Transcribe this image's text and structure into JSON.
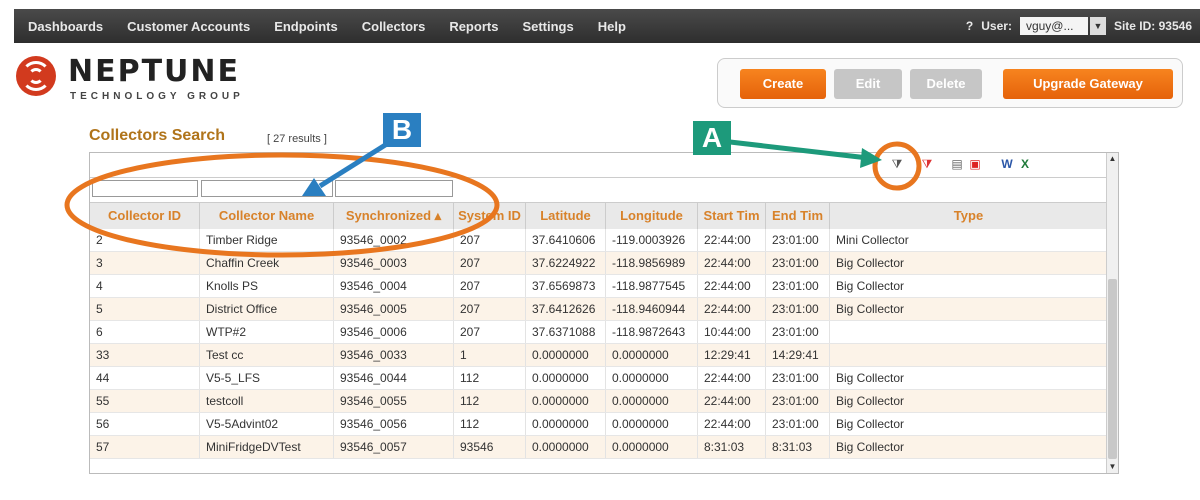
{
  "nav": {
    "items": [
      "Dashboards",
      "Customer Accounts",
      "Endpoints",
      "Collectors",
      "Reports",
      "Settings",
      "Help"
    ],
    "help": "?",
    "user_label": "User:",
    "user_value": "vguy@...",
    "site_label": "Site ID: 93546"
  },
  "logo": {
    "name": "NEPTUNE",
    "sub": "TECHNOLOGY GROUP"
  },
  "buttons": {
    "create": "Create",
    "edit": "Edit",
    "delete": "Delete",
    "upgrade": "Upgrade Gateway"
  },
  "search": {
    "title": "Collectors Search",
    "results": "[ 27 results ]"
  },
  "table": {
    "headers": [
      "Collector ID",
      "Collector Name",
      "Synchronized ▴",
      "System ID",
      "Latitude",
      "Longitude",
      "Start Tim",
      "End Tim",
      "Type"
    ],
    "rows": [
      [
        "2",
        "Timber Ridge",
        "93546_0002",
        "207",
        "37.6410606",
        "-119.0003926",
        "22:44:00",
        "23:01:00",
        "Mini Collector"
      ],
      [
        "3",
        "Chaffin Creek",
        "93546_0003",
        "207",
        "37.6224922",
        "-118.9856989",
        "22:44:00",
        "23:01:00",
        "Big Collector"
      ],
      [
        "4",
        "Knolls PS",
        "93546_0004",
        "207",
        "37.6569873",
        "-118.9877545",
        "22:44:00",
        "23:01:00",
        "Big Collector"
      ],
      [
        "5",
        "District Office",
        "93546_0005",
        "207",
        "37.6412626",
        "-118.9460944",
        "22:44:00",
        "23:01:00",
        "Big Collector"
      ],
      [
        "6",
        "WTP#2",
        "93546_0006",
        "207",
        "37.6371088",
        "-118.9872643",
        "10:44:00",
        "23:01:00",
        ""
      ],
      [
        "33",
        "Test cc",
        "93546_0033",
        "1",
        "0.0000000",
        "0.0000000",
        "12:29:41",
        "14:29:41",
        ""
      ],
      [
        "44",
        "V5-5_LFS",
        "93546_0044",
        "112",
        "0.0000000",
        "0.0000000",
        "22:44:00",
        "23:01:00",
        "Big Collector"
      ],
      [
        "55",
        "testcoll",
        "93546_0055",
        "112",
        "0.0000000",
        "0.0000000",
        "22:44:00",
        "23:01:00",
        "Big Collector"
      ],
      [
        "56",
        "V5-5Advint02",
        "93546_0056",
        "112",
        "0.0000000",
        "0.0000000",
        "22:44:00",
        "23:01:00",
        "Big Collector"
      ],
      [
        "57",
        "MiniFridgeDVTest",
        "93546_0057",
        "93546",
        "0.0000000",
        "0.0000000",
        "8:31:03",
        "8:31:03",
        "Big Collector"
      ]
    ]
  },
  "annotations": {
    "a": "A",
    "b": "B"
  },
  "colors": {
    "accent": "#e5620a",
    "header_text": "#d8822a",
    "annotation_green": "#1d9a7b",
    "annotation_blue": "#2a7fc1"
  },
  "icons": [
    "filter-icon",
    "clear-filter-icon",
    "print-icon",
    "pdf-icon",
    "word-icon",
    "excel-icon"
  ]
}
